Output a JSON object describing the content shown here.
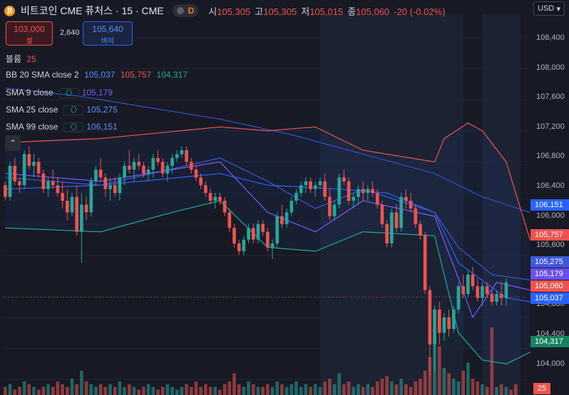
{
  "header": {
    "coin_glyph": "₿",
    "symbol": "비트코인 CME 퓨처스 · 15 · CME",
    "delay_badge": "D",
    "open_label": "시",
    "open": "105,305",
    "high_label": "고",
    "high": "105,305",
    "low_label": "저",
    "low": "105,015",
    "close_label": "종",
    "close": "105,060",
    "change": "-20 (-0.02%)"
  },
  "trade": {
    "sell_price": "103,000",
    "sell_label": "셀",
    "spread": "2,640",
    "buy_price": "105,640",
    "buy_label": "바이"
  },
  "indicators": {
    "volume_label": "볼륨",
    "volume_value": "25",
    "bb_label": "BB 20 SMA close 2",
    "bb_basis": "105,037",
    "bb_upper": "105,757",
    "bb_lower": "104,317",
    "sma9_label": "SMA 9 close",
    "sma9_value": "105,179",
    "sma25_label": "SMA 25 close",
    "sma25_value": "105,275",
    "sma99_label": "SMA 99 close",
    "sma99_value": "106,151",
    "brace_glyph": "〈〉",
    "collapse_glyph": "⌃"
  },
  "axis": {
    "currency": "USD",
    "currency_chevron": "▾",
    "ticks": [
      "108,400",
      "108,000",
      "107,600",
      "107,200",
      "106,800",
      "106,400",
      "106,000",
      "105,600",
      "104,800",
      "104,400",
      "104,000"
    ]
  },
  "price_labels": {
    "sma99": "106,151",
    "bb_upper": "105,757",
    "sma25": "105,275",
    "sma9": "105,179",
    "last": "105,060",
    "bb_basis": "105,037",
    "bb_lower": "104,317",
    "volume": "25"
  },
  "colors": {
    "background": "#171a24",
    "up": "#26a69a",
    "down": "#ef5350",
    "bb_upper": "#ef5350",
    "bb_basis": "#2962ff",
    "bb_lower": "#26a69a",
    "sma9": "#7b5cff",
    "sma25": "#3f58d8",
    "sma99": "#3151c9",
    "session_shade": "#1f2a3d"
  },
  "chart_data": {
    "type": "candlestick",
    "yrange": [
      103800,
      108700
    ],
    "y_ticks": [
      104000,
      104400,
      104800,
      105600,
      106000,
      106400,
      106800,
      107200,
      107600,
      108000,
      108400
    ],
    "candles": [
      [
        106500,
        106550,
        106300,
        106350
      ],
      [
        106350,
        106800,
        106300,
        106750
      ],
      [
        106750,
        106850,
        106500,
        106550
      ],
      [
        106550,
        106600,
        106400,
        106500
      ],
      [
        106500,
        106950,
        106450,
        106900
      ],
      [
        106900,
        107000,
        106700,
        106750
      ],
      [
        106750,
        106900,
        106600,
        106800
      ],
      [
        106800,
        106850,
        106600,
        106650
      ],
      [
        106650,
        106700,
        106400,
        106450
      ],
      [
        106450,
        106600,
        106350,
        106550
      ],
      [
        106550,
        106700,
        106450,
        106500
      ],
      [
        106500,
        106600,
        106350,
        106400
      ],
      [
        106400,
        106550,
        106200,
        106300
      ],
      [
        106300,
        106450,
        106050,
        106150
      ],
      [
        106150,
        106400,
        106100,
        106350
      ],
      [
        106350,
        106500,
        105850,
        105900
      ],
      [
        105900,
        106400,
        105500,
        106250
      ],
      [
        106250,
        106350,
        106050,
        106150
      ],
      [
        106150,
        106600,
        106100,
        106550
      ],
      [
        106550,
        106750,
        106500,
        106700
      ],
      [
        106700,
        106850,
        106550,
        106600
      ],
      [
        106600,
        106650,
        106350,
        106450
      ],
      [
        106450,
        106600,
        106300,
        106500
      ],
      [
        106500,
        106600,
        106350,
        106400
      ],
      [
        106400,
        106650,
        106300,
        106600
      ],
      [
        106600,
        106800,
        106500,
        106750
      ],
      [
        106750,
        106950,
        106650,
        106700
      ],
      [
        106700,
        106850,
        106550,
        106800
      ],
      [
        106800,
        106900,
        106700,
        106750
      ],
      [
        106750,
        106800,
        106600,
        106650
      ],
      [
        106650,
        106750,
        106550,
        106700
      ],
      [
        106700,
        106900,
        106600,
        106850
      ],
      [
        106850,
        106950,
        106750,
        106800
      ],
      [
        106800,
        106850,
        106600,
        106650
      ],
      [
        106650,
        106800,
        106550,
        106750
      ],
      [
        106750,
        106900,
        106650,
        106850
      ],
      [
        106850,
        106950,
        106800,
        106900
      ],
      [
        106900,
        107000,
        106850,
        106950
      ],
      [
        106950,
        107000,
        106750,
        106800
      ],
      [
        106800,
        106850,
        106650,
        106700
      ],
      [
        106700,
        106750,
        106550,
        106600
      ],
      [
        106600,
        106650,
        106450,
        106500
      ],
      [
        106500,
        106550,
        106350,
        106400
      ],
      [
        106400,
        106450,
        106250,
        106300
      ],
      [
        106300,
        106400,
        106200,
        106350
      ],
      [
        106350,
        106400,
        106250,
        106300
      ],
      [
        106300,
        106350,
        106100,
        106150
      ],
      [
        106150,
        106200,
        105900,
        105950
      ],
      [
        105950,
        106000,
        105700,
        105750
      ],
      [
        105750,
        105800,
        105600,
        105650
      ],
      [
        105650,
        105850,
        105600,
        105800
      ],
      [
        105800,
        106000,
        105750,
        105950
      ],
      [
        105950,
        106000,
        105750,
        105800
      ],
      [
        105800,
        106050,
        105750,
        106000
      ],
      [
        106000,
        106050,
        105850,
        105900
      ],
      [
        105900,
        105950,
        105650,
        105700
      ],
      [
        105700,
        105800,
        105550,
        105750
      ],
      [
        105750,
        106150,
        105700,
        106100
      ],
      [
        106100,
        106250,
        105950,
        106000
      ],
      [
        106000,
        106200,
        105950,
        106150
      ],
      [
        106150,
        106350,
        106100,
        106300
      ],
      [
        106300,
        106450,
        106250,
        106400
      ],
      [
        106400,
        106550,
        106350,
        106500
      ],
      [
        106500,
        106600,
        106400,
        106550
      ],
      [
        106550,
        106600,
        106400,
        106450
      ],
      [
        106450,
        106550,
        106350,
        106500
      ],
      [
        106500,
        106600,
        106450,
        106550
      ],
      [
        106550,
        106650,
        106300,
        106350
      ],
      [
        106350,
        106450,
        106050,
        106100
      ],
      [
        106100,
        106300,
        106050,
        106250
      ],
      [
        106250,
        106650,
        106200,
        106600
      ],
      [
        106600,
        106700,
        106500,
        106550
      ],
      [
        106550,
        106600,
        106250,
        106300
      ],
      [
        106300,
        106400,
        106200,
        106350
      ],
      [
        106350,
        106500,
        106250,
        106450
      ],
      [
        106450,
        106550,
        106300,
        106400
      ],
      [
        106400,
        106500,
        106300,
        106450
      ],
      [
        106450,
        106550,
        106350,
        106400
      ],
      [
        106400,
        106450,
        106200,
        106250
      ],
      [
        106250,
        106300,
        105950,
        106000
      ],
      [
        106000,
        106050,
        105700,
        105750
      ],
      [
        105750,
        106200,
        105700,
        106150
      ],
      [
        106150,
        106250,
        105900,
        105950
      ],
      [
        105950,
        106400,
        105900,
        106350
      ],
      [
        106350,
        106450,
        106200,
        106300
      ],
      [
        106300,
        106400,
        106150,
        106200
      ],
      [
        106200,
        106250,
        105950,
        106000
      ],
      [
        106000,
        106050,
        105800,
        105850
      ],
      [
        105850,
        105900,
        105100,
        105150
      ],
      [
        105150,
        105200,
        104050,
        104450
      ],
      [
        104450,
        104950,
        104100,
        104900
      ],
      [
        104900,
        105000,
        104450,
        104600
      ],
      [
        104600,
        104850,
        104500,
        104800
      ],
      [
        104800,
        104900,
        104550,
        104650
      ],
      [
        104650,
        104950,
        104600,
        104900
      ],
      [
        104900,
        105250,
        104850,
        105200
      ],
      [
        105200,
        105350,
        105050,
        105100
      ],
      [
        105100,
        105400,
        105050,
        105350
      ],
      [
        105350,
        105450,
        105150,
        105200
      ],
      [
        105200,
        105300,
        105000,
        105050
      ],
      [
        105050,
        105250,
        104950,
        105200
      ],
      [
        105200,
        105250,
        105050,
        105100
      ],
      [
        105100,
        105150,
        104950,
        105000
      ],
      [
        105000,
        105150,
        104950,
        105100
      ],
      [
        105100,
        105250,
        104950,
        105050
      ],
      [
        105050,
        105300,
        104950,
        105250
      ]
    ],
    "bb_upper": [
      [
        0,
        107050
      ],
      [
        20,
        107100
      ],
      [
        45,
        107250
      ],
      [
        55,
        107200
      ],
      [
        65,
        107250
      ],
      [
        75,
        106950
      ],
      [
        85,
        106850
      ],
      [
        90,
        106800
      ],
      [
        92,
        107100
      ],
      [
        97,
        107300
      ],
      [
        100,
        107200
      ],
      [
        105,
        106800
      ],
      [
        110,
        105800
      ]
    ],
    "bb_basis": [
      [
        0,
        106450
      ],
      [
        20,
        106500
      ],
      [
        45,
        106650
      ],
      [
        55,
        106500
      ],
      [
        70,
        106450
      ],
      [
        80,
        106400
      ],
      [
        90,
        106150
      ],
      [
        95,
        105500
      ],
      [
        105,
        105050
      ],
      [
        110,
        105000
      ]
    ],
    "bb_lower": [
      [
        0,
        105950
      ],
      [
        20,
        105900
      ],
      [
        35,
        106150
      ],
      [
        45,
        106300
      ],
      [
        55,
        105700
      ],
      [
        65,
        105650
      ],
      [
        75,
        105900
      ],
      [
        90,
        105850
      ],
      [
        95,
        104600
      ],
      [
        100,
        104250
      ],
      [
        105,
        104200
      ],
      [
        110,
        104350
      ]
    ],
    "sma9": [
      [
        0,
        106650
      ],
      [
        20,
        106550
      ],
      [
        45,
        106800
      ],
      [
        55,
        106150
      ],
      [
        65,
        105900
      ],
      [
        75,
        106300
      ],
      [
        90,
        106100
      ],
      [
        95,
        105300
      ],
      [
        98,
        104800
      ],
      [
        103,
        105250
      ],
      [
        110,
        105150
      ]
    ],
    "sma25": [
      [
        0,
        106600
      ],
      [
        20,
        106500
      ],
      [
        45,
        106850
      ],
      [
        55,
        106550
      ],
      [
        65,
        106200
      ],
      [
        75,
        106450
      ],
      [
        90,
        106150
      ],
      [
        95,
        105700
      ],
      [
        102,
        105350
      ],
      [
        110,
        105280
      ]
    ],
    "sma99": [
      [
        0,
        107750
      ],
      [
        15,
        107650
      ],
      [
        30,
        107500
      ],
      [
        45,
        107350
      ],
      [
        60,
        107150
      ],
      [
        75,
        106900
      ],
      [
        90,
        106650
      ],
      [
        100,
        106350
      ],
      [
        110,
        106150
      ]
    ],
    "volume": [
      3,
      4,
      2,
      3,
      5,
      4,
      3,
      2,
      3,
      4,
      3,
      5,
      4,
      3,
      6,
      4,
      9,
      5,
      4,
      3,
      4,
      3,
      4,
      3,
      5,
      3,
      4,
      3,
      2,
      3,
      4,
      3,
      2,
      3,
      4,
      3,
      2,
      3,
      4,
      3,
      5,
      3,
      4,
      3,
      3,
      2,
      4,
      5,
      8,
      4,
      3,
      5,
      4,
      3,
      3,
      4,
      3,
      5,
      4,
      3,
      4,
      5,
      3,
      4,
      3,
      4,
      3,
      5,
      6,
      4,
      8,
      4,
      5,
      3,
      4,
      3,
      4,
      3,
      5,
      6,
      7,
      5,
      4,
      6,
      4,
      3,
      5,
      6,
      9,
      14,
      22,
      18,
      10,
      8,
      6,
      5,
      9,
      12,
      6,
      5,
      4,
      3,
      25,
      3,
      4,
      3,
      2,
      4
    ]
  }
}
